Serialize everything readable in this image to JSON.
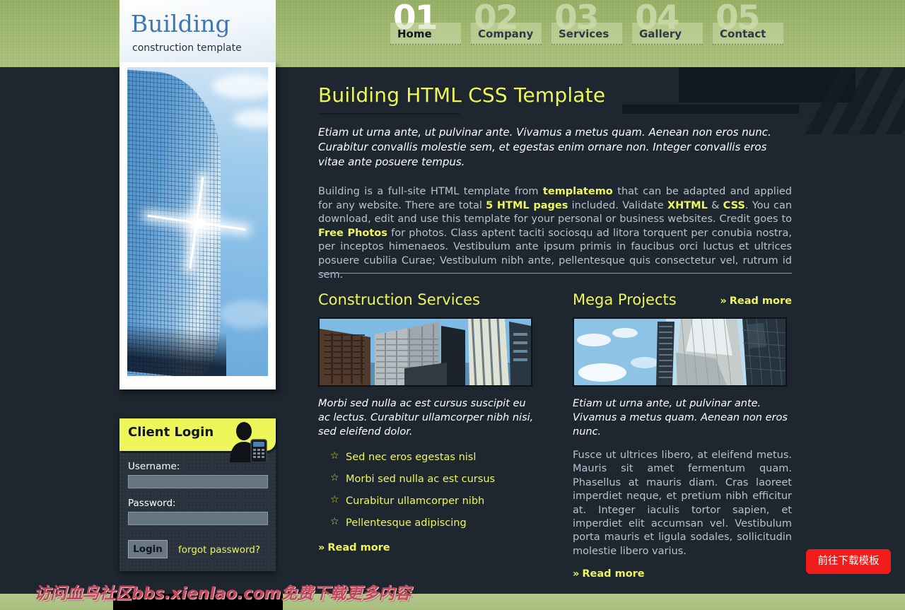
{
  "site": {
    "logo_title": "Building",
    "logo_subtitle": "construction template"
  },
  "colors": {
    "header_green": "#9cb56c",
    "body_dark": "#1e2630",
    "accent_yellow": "#eef65a",
    "logo_blue": "#3f76b8",
    "download_red": "#f21c1c",
    "watermark_red": "#c24a5c"
  },
  "nav": {
    "items": [
      {
        "num": "01",
        "label": "Home",
        "active": true
      },
      {
        "num": "02",
        "label": "Company",
        "active": false
      },
      {
        "num": "03",
        "label": "Services",
        "active": false
      },
      {
        "num": "04",
        "label": "Gallery",
        "active": false
      },
      {
        "num": "05",
        "label": "Contact",
        "active": false
      }
    ]
  },
  "main": {
    "title": "Building HTML CSS Template",
    "intro_italic": "Etiam ut urna ante, ut pulvinar ante. Vivamus a metus quam. Aenean non eros nunc. Curabitur convallis molestie sem, et egestas enim ornare non. Integer convallis eros vitae ante posuere tempus.",
    "body_parts": {
      "p1": "Building is a full-site HTML template from ",
      "link1": "templatemo",
      "p2": " that can be adapted and applied for any website. There are total ",
      "link2": "5 HTML pages",
      "p3": " included. Validate ",
      "link3": "XHTML",
      "p4": " & ",
      "link4": "CSS",
      "p5": ". You can download, edit and use this template for your personal or business websites. Credit goes to ",
      "link5": "Free Photos",
      "p6": " for photos. Class aptent taciti sociosqu ad litora torquent per conubia nostra, per inceptos himenaeos. Vestibulum ante ipsum primis in faucibus orci luctus et ultrices posuere cubilia Curae; Vestibulum nibh ante, pellentesque quis consectetur vel, rutrum id sem."
    },
    "read_more": "Read more",
    "chevron": "»"
  },
  "columns": [
    {
      "title": "Construction Services",
      "image_alt": "office-towers-photo",
      "italic": "Morbi sed nulla ac est cursus suscipit eu ac lectus. Curabitur ullamcorper nibh nisi, sed eleifend dolor.",
      "list": [
        "Sed nec eros egestas nisl",
        "Morbi sed nulla ac est cursus",
        "Curabitur ullamcorper nibh",
        "Pellentesque adipiscing"
      ],
      "star": "☆",
      "read_more": "Read more"
    },
    {
      "title": "Mega Projects",
      "image_alt": "glass-facade-photo",
      "italic": "Etiam ut urna ante, ut pulvinar ante. Vivamus a metus quam. Aenean non eros nunc.",
      "body": "Fusce ut ultrices libero, at eleifend metus. Mauris sit amet fermentum quam. Phasellus at mauris diam. Cras laoreet imperdiet neque, et pretium nibh efficitur at. Integer iaculis tortor sapien, et imperdiet elit accumsan vel. Vestibulum porta mauris et ligula sodales, sollicitudin molestie libero varius.",
      "read_more": "Read more"
    }
  ],
  "login": {
    "title": "Client Login",
    "username_label": "Username:",
    "username_value": "",
    "username_placeholder": "",
    "password_label": "Password:",
    "password_value": "",
    "password_placeholder": "",
    "login_button": "Login",
    "forgot_link": "forgot password?"
  },
  "overlay": {
    "watermark": "访问血鸟社区bbs.xienlao.com免费下载更多内容",
    "download_button": "前往下载模板"
  }
}
